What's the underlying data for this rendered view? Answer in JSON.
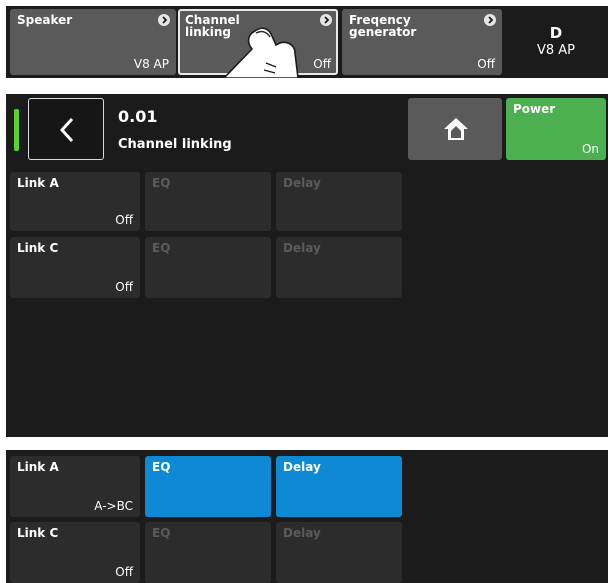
{
  "top_strip": {
    "tiles": [
      {
        "label": "Speaker",
        "value": "V8 AP"
      },
      {
        "label": "Channel\nlinking",
        "value": "Off"
      },
      {
        "label": "Freqency\ngenerator",
        "value": "Off"
      }
    ],
    "device": {
      "letter": "D",
      "model": "V8 AP"
    }
  },
  "header": {
    "value": "0.01",
    "title": "Channel linking",
    "power_label": "Power",
    "power_value": "On"
  },
  "grid_off": {
    "rows": [
      {
        "label": "Link A",
        "value": "Off",
        "eq": "EQ",
        "delay": "Delay"
      },
      {
        "label": "Link C",
        "value": "Off",
        "eq": "EQ",
        "delay": "Delay"
      }
    ]
  },
  "grid_on": {
    "rows": [
      {
        "label": "Link A",
        "value": "A->BC",
        "eq": "EQ",
        "delay": "Delay"
      },
      {
        "label": "Link C",
        "value": "Off",
        "eq": "EQ",
        "delay": "Delay"
      }
    ]
  },
  "colors": {
    "accent": "#0e8ad4",
    "power": "#4caf50",
    "status_bar": "#5ad12c"
  }
}
